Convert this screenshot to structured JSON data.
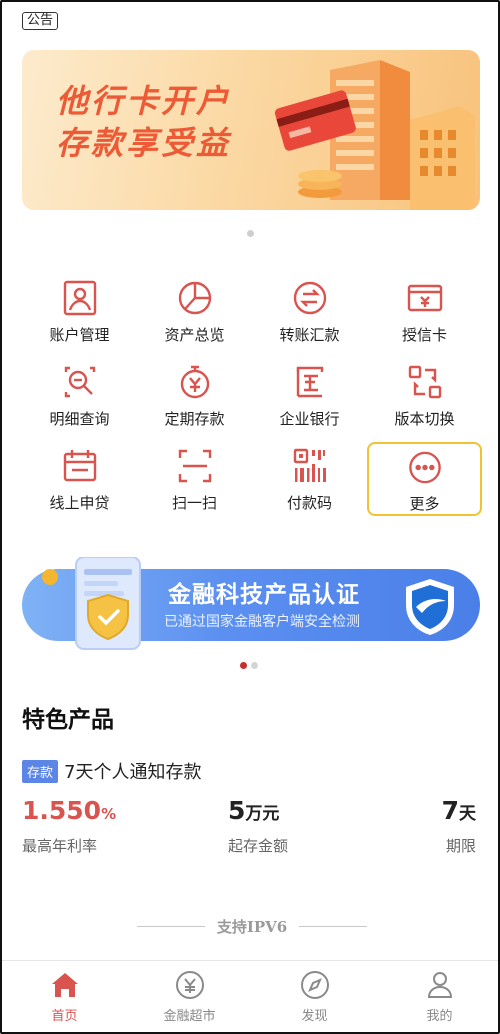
{
  "notice": {
    "tag": "公告"
  },
  "banner": {
    "line1": "他行卡开户",
    "line2": "存款享受益"
  },
  "grid": [
    {
      "label": "账户管理",
      "icon": "account-icon"
    },
    {
      "label": "资产总览",
      "icon": "pie-chart-icon"
    },
    {
      "label": "转账汇款",
      "icon": "transfer-icon"
    },
    {
      "label": "授信卡",
      "icon": "credit-card-icon"
    },
    {
      "label": "明细查询",
      "icon": "search-doc-icon"
    },
    {
      "label": "定期存款",
      "icon": "stopwatch-yuan-icon"
    },
    {
      "label": "企业银行",
      "icon": "enterprise-icon"
    },
    {
      "label": "版本切换",
      "icon": "switch-icon"
    },
    {
      "label": "线上申贷",
      "icon": "calendar-icon"
    },
    {
      "label": "扫一扫",
      "icon": "scan-icon"
    },
    {
      "label": "付款码",
      "icon": "barcode-icon"
    },
    {
      "label": "更多",
      "icon": "more-icon"
    }
  ],
  "promo": {
    "title": "金融科技产品认证",
    "subtitle": "已通过国家金融客户端安全检测"
  },
  "section": {
    "title": "特色产品"
  },
  "product": {
    "badge": "存款",
    "name": "7天个人通知存款",
    "rate_value": "1.550",
    "rate_unit": "%",
    "rate_label": "最高年利率",
    "min_value": "5",
    "min_unit": "万元",
    "min_label": "起存金额",
    "term_value": "7",
    "term_unit": "天",
    "term_label": "期限"
  },
  "footer": {
    "ipv6": "支持IPV6"
  },
  "tabs": [
    {
      "label": "首页",
      "icon": "home-icon",
      "active": true
    },
    {
      "label": "金融超市",
      "icon": "yuan-circle-icon",
      "active": false
    },
    {
      "label": "发现",
      "icon": "compass-icon",
      "active": false
    },
    {
      "label": "我的",
      "icon": "user-icon",
      "active": false
    }
  ],
  "colors": {
    "accent": "#d9534f",
    "highlight": "#f1c232",
    "promo": "#5b8ff0"
  }
}
